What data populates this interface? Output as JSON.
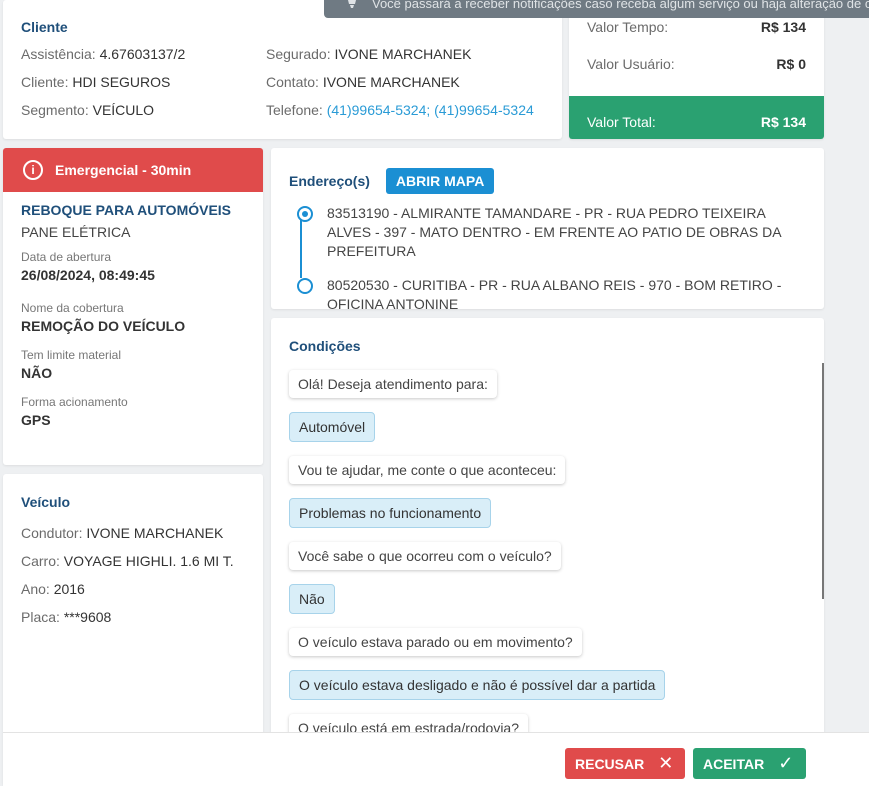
{
  "notification": {
    "text": "Você passará a receber notificações caso receba algum serviço ou haja alteração de c"
  },
  "client": {
    "title": "Cliente",
    "fields": [
      {
        "label": "Assistência:",
        "value": "4.67603137/2"
      },
      {
        "label": "Segurado:",
        "value": "IVONE MARCHANEK"
      },
      {
        "label": "Cliente:",
        "value": "HDI SEGUROS"
      },
      {
        "label": "Contato:",
        "value": "IVONE MARCHANEK"
      },
      {
        "label": "Segmento:",
        "value": "VEÍCULO"
      },
      {
        "label": "Telefone:",
        "value": "(41)99654-5324; (41)99654-5324"
      }
    ]
  },
  "values": {
    "rows": [
      {
        "label": "Valor Tempo:",
        "amount": "R$ 134"
      },
      {
        "label": "Valor Usuário:",
        "amount": "R$ 0"
      }
    ],
    "total": {
      "label": "Valor Total:",
      "amount": "R$ 134"
    },
    "colors": {
      "total_bg": "#2aa171"
    }
  },
  "service": {
    "priority": "Emergencial - 30min",
    "priority_color": "#e04b4b",
    "type": "REBOQUE PARA AUTOMÓVEIS",
    "subtype": "PANE ELÉTRICA",
    "details": [
      {
        "label": "Data de abertura",
        "value": "26/08/2024, 08:49:45"
      },
      {
        "label": "Nome da cobertura",
        "value": "REMOÇÃO DO VEÍCULO"
      },
      {
        "label": "Tem limite material",
        "value": "NÃO"
      },
      {
        "label": "Forma acionamento",
        "value": "GPS"
      }
    ]
  },
  "vehicle": {
    "title": "Veículo",
    "fields": [
      {
        "label": "Condutor:",
        "value": "IVONE MARCHANEK"
      },
      {
        "label": "Carro:",
        "value": "VOYAGE HIGHLI. 1.6 MI T."
      },
      {
        "label": "Ano:",
        "value": "2016"
      },
      {
        "label": "Placa:",
        "value": "***9608"
      }
    ]
  },
  "address": {
    "title": "Endereço(s)",
    "map_button": "ABRIR MAPA",
    "items": [
      "83513190 - ALMIRANTE TAMANDARE - PR - RUA PEDRO TEIXEIRA ALVES - 397 - MATO DENTRO - EM FRENTE AO PATIO DE OBRAS DA PREFEITURA",
      "80520530 - CURITIBA - PR - RUA ALBANO REIS - 970 - BOM RETIRO - OFICINA ANTONINE"
    ]
  },
  "conditions": {
    "title": "Condições",
    "messages": [
      {
        "kind": "q",
        "text": "Olá! Deseja atendimento para:"
      },
      {
        "kind": "a",
        "text": "Automóvel"
      },
      {
        "kind": "q",
        "text": "Vou te ajudar, me conte o que aconteceu:"
      },
      {
        "kind": "a",
        "text": "Problemas no funcionamento"
      },
      {
        "kind": "q",
        "text": "Você sabe o que ocorreu com o veículo?"
      },
      {
        "kind": "a",
        "text": "Não"
      },
      {
        "kind": "q",
        "text": "O veículo estava parado ou em movimento?"
      },
      {
        "kind": "a",
        "text": "O veículo estava desligado e não é possível dar a partida"
      },
      {
        "kind": "q",
        "text": "O veículo está em estrada/rodovia?"
      }
    ]
  },
  "actions": {
    "reject": "RECUSAR",
    "accept": "ACEITAR"
  }
}
